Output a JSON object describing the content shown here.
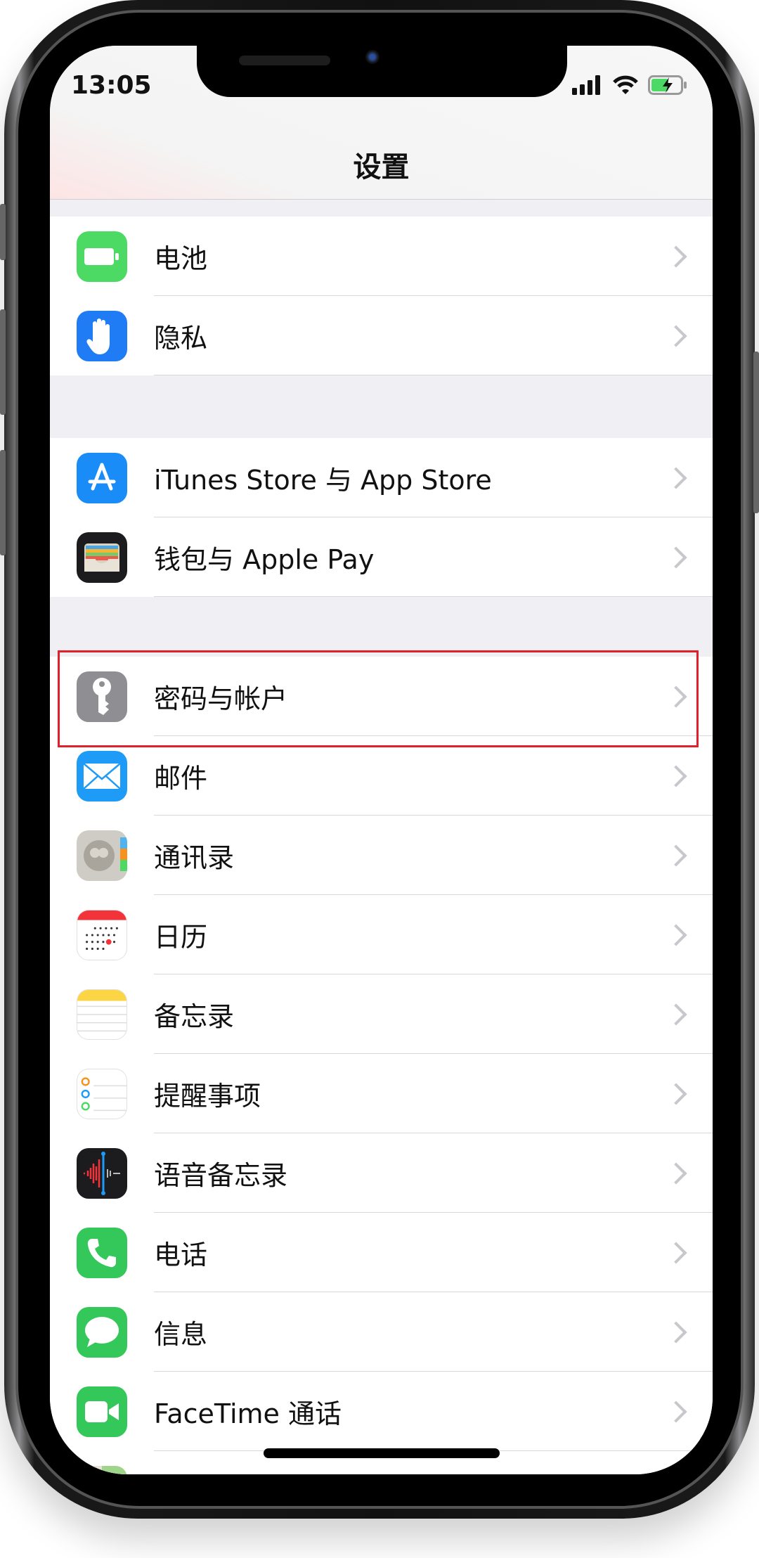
{
  "status_bar": {
    "time": "13:05",
    "battery_state": "charging",
    "battery_color": "#4cd964"
  },
  "header": {
    "title": "设置"
  },
  "groups": [
    {
      "rows": [
        {
          "label": "电池",
          "icon": "battery-icon",
          "color": "#4cd964"
        },
        {
          "label": "隐私",
          "icon": "hand-icon",
          "color": "#1f7cf5"
        }
      ]
    },
    {
      "rows": [
        {
          "label": "iTunes Store 与 App Store",
          "icon": "app-store-icon",
          "color": "#1a8cf8"
        },
        {
          "label": "钱包与 Apple Pay",
          "icon": "wallet-icon",
          "color": "#1c1c1e"
        }
      ]
    },
    {
      "rows": [
        {
          "label": "密码与帐户",
          "icon": "key-icon",
          "color": "#8e8e93",
          "highlighted": true
        },
        {
          "label": "邮件",
          "icon": "mail-icon",
          "color": "#1e9bf7"
        },
        {
          "label": "通讯录",
          "icon": "contacts-icon",
          "color": "#cfccc6"
        },
        {
          "label": "日历",
          "icon": "calendar-icon",
          "color": "#ffffff"
        },
        {
          "label": "备忘录",
          "icon": "notes-icon",
          "color": "#ffffff"
        },
        {
          "label": "提醒事项",
          "icon": "reminders-icon",
          "color": "#ffffff"
        },
        {
          "label": "语音备忘录",
          "icon": "voice-memos-icon",
          "color": "#1c1c1e"
        },
        {
          "label": "电话",
          "icon": "phone-icon",
          "color": "#34c759"
        },
        {
          "label": "信息",
          "icon": "messages-icon",
          "color": "#34c759"
        },
        {
          "label": "FaceTime 通话",
          "icon": "facetime-icon",
          "color": "#34c759"
        },
        {
          "label": "",
          "icon": "maps-icon",
          "color": "#9fd58a"
        }
      ]
    }
  ],
  "highlight_color": "#e0202a"
}
